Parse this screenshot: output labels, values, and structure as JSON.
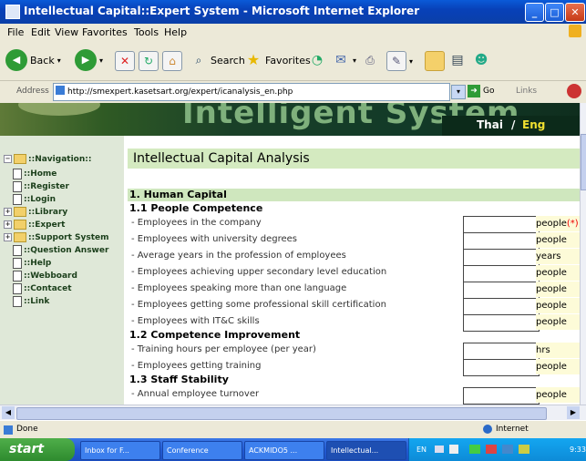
{
  "window": {
    "title": "Intellectual Capital::Expert System - Microsoft Internet Explorer"
  },
  "menu": [
    "File",
    "Edit",
    "View",
    "Favorites",
    "Tools",
    "Help"
  ],
  "toolbar": {
    "back": "Back",
    "search": "Search",
    "favorites": "Favorites"
  },
  "address": {
    "label": "Address",
    "url": "http://smexpert.kasetsart.org/expert/icanalysis_en.php",
    "go": "Go",
    "links": "Links"
  },
  "banner": {
    "title": "Intelligent System",
    "lang_thai": "Thai",
    "lang_sep": "/",
    "lang_eng": "Eng"
  },
  "sidebar": {
    "root": "::Navigation::",
    "items": [
      {
        "label": "::Home",
        "type": "doc"
      },
      {
        "label": "::Register",
        "type": "doc"
      },
      {
        "label": "::Login",
        "type": "doc"
      },
      {
        "label": "::Library",
        "type": "folder"
      },
      {
        "label": "::Expert",
        "type": "folder"
      },
      {
        "label": "::Support System",
        "type": "folder"
      },
      {
        "label": "::Question Answer",
        "type": "doc"
      },
      {
        "label": "::Help",
        "type": "doc"
      },
      {
        "label": "::Webboard",
        "type": "doc"
      },
      {
        "label": "::Contacet",
        "type": "doc"
      },
      {
        "label": "::Link",
        "type": "doc"
      }
    ]
  },
  "content": {
    "heading": "Intellectual Capital Analysis",
    "section": "1. Human Capital",
    "subs": [
      "1.1 People Competence",
      "1.2 Competence Improvement",
      "1.3 Staff Stability"
    ],
    "rows": [
      {
        "label": "- Employees in the company",
        "unit": "people",
        "req": "(*)"
      },
      {
        "label": "- Employees with university degrees",
        "unit": "people",
        "req": ""
      },
      {
        "label": "- Average years in the profession of employees",
        "unit": "years",
        "req": ""
      },
      {
        "label": "- Employees achieving upper secondary level education",
        "unit": "people",
        "req": ""
      },
      {
        "label": "- Employees speaking more than one language",
        "unit": "people",
        "req": ""
      },
      {
        "label": "- Employees getting some professional skill certification",
        "unit": "people",
        "req": ""
      },
      {
        "label": "- Employees with IT&C skills",
        "unit": "people",
        "req": ""
      },
      {
        "label": "- Training hours per employee (per year)",
        "unit": "hrs",
        "req": ""
      },
      {
        "label": "- Employees getting training",
        "unit": "people",
        "req": ""
      },
      {
        "label": "- Annual employee turnover",
        "unit": "people",
        "req": ""
      }
    ]
  },
  "status": {
    "text": "Done",
    "zone": "Internet"
  },
  "taskbar": {
    "start": "start",
    "tasks": [
      "Inbox for F...",
      "Conference",
      "ACKMIDO5 ...",
      "Intellectual..."
    ],
    "lang": "EN",
    "clock": "9:33"
  }
}
